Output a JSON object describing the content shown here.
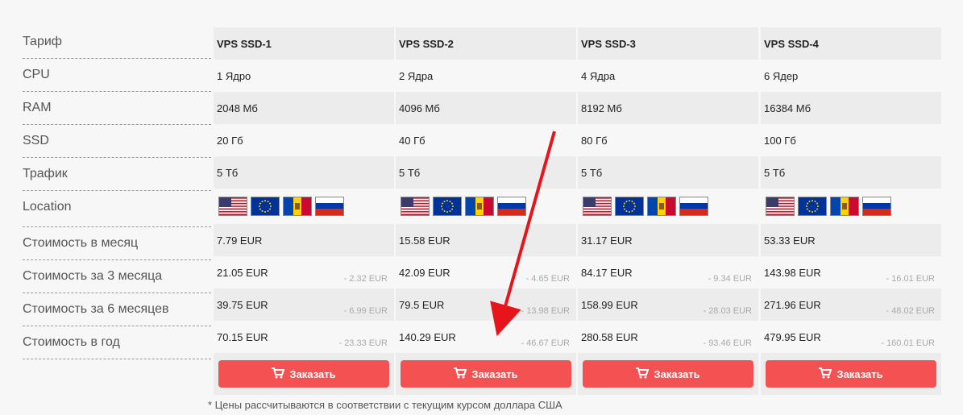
{
  "labels": {
    "tariff": "Тариф",
    "cpu": "CPU",
    "ram": "RAM",
    "ssd": "SSD",
    "traffic": "Трафик",
    "location": "Location",
    "price_month": "Стоимость в месяц",
    "price_3m": "Стоимость за 3 месяца",
    "price_6m": "Стоимость за 6 месяцев",
    "price_year": "Стоимость в год"
  },
  "plans": [
    {
      "name": "VPS SSD-1",
      "cpu": "1 Ядро",
      "ram": "2048 Мб",
      "ssd": "20 Гб",
      "traffic": "5 Тб",
      "month": "7.79 EUR",
      "m3": "21.05 EUR",
      "m3_disc": "- 2.32 EUR",
      "m6": "39.75 EUR",
      "m6_disc": "- 6.99 EUR",
      "year": "70.15 EUR",
      "year_disc": "- 23.33 EUR"
    },
    {
      "name": "VPS SSD-2",
      "cpu": "2 Ядра",
      "ram": "4096 Мб",
      "ssd": "40 Гб",
      "traffic": "5 Тб",
      "month": "15.58 EUR",
      "m3": "42.09 EUR",
      "m3_disc": "- 4.65 EUR",
      "m6": "79.5 EUR",
      "m6_disc": "- 13.98 EUR",
      "year": "140.29 EUR",
      "year_disc": "- 46.67 EUR"
    },
    {
      "name": "VPS SSD-3",
      "cpu": "4 Ядра",
      "ram": "8192 Мб",
      "ssd": "80 Гб",
      "traffic": "5 Тб",
      "month": "31.17 EUR",
      "m3": "84.17 EUR",
      "m3_disc": "- 9.34 EUR",
      "m6": "158.99 EUR",
      "m6_disc": "- 28.03 EUR",
      "year": "280.58 EUR",
      "year_disc": "- 93.46 EUR"
    },
    {
      "name": "VPS SSD-4",
      "cpu": "6 Ядер",
      "ram": "16384 Мб",
      "ssd": "100 Гб",
      "traffic": "5 Тб",
      "month": "53.33 EUR",
      "m3": "143.98 EUR",
      "m3_disc": "- 16.01 EUR",
      "m6": "271.96 EUR",
      "m6_disc": "- 48.02 EUR",
      "year": "479.95 EUR",
      "year_disc": "- 160.01 EUR"
    }
  ],
  "flags": [
    "us-flag-icon",
    "eu-flag-icon",
    "moldova-flag-icon",
    "russia-flag-icon"
  ],
  "order_label": "Заказать",
  "footnote": "* Цены рассчитываются в соответствии с текущим курсом доллара США",
  "colors": {
    "accent": "#f45153",
    "arrow": "#e8141b",
    "cell_bg": "#ececec"
  }
}
